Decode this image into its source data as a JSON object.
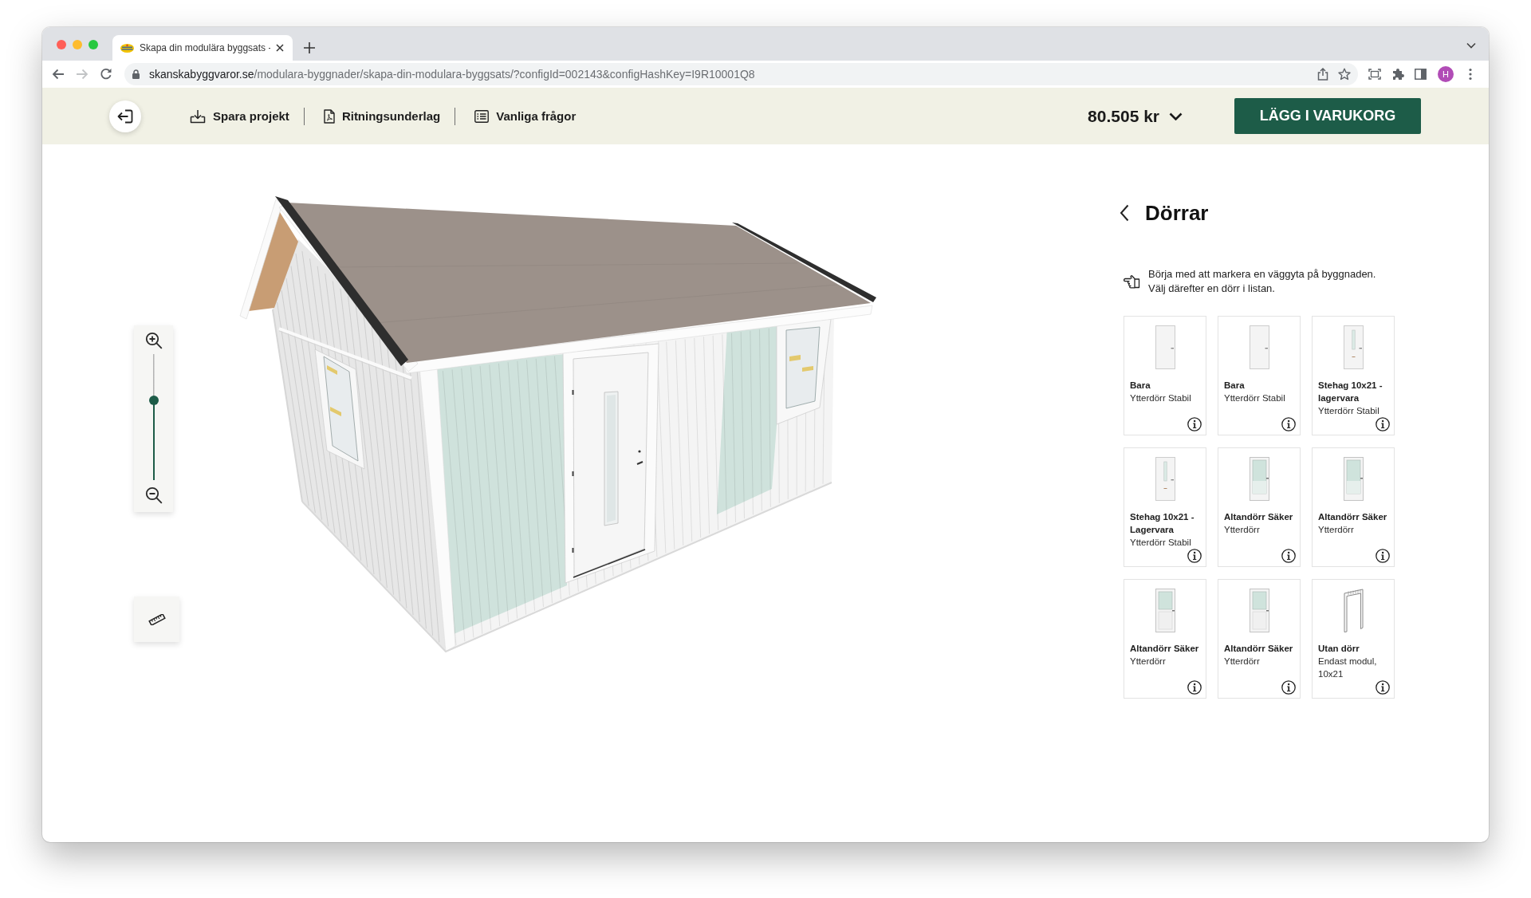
{
  "browser": {
    "tabs": [
      {
        "title": "Skapa din modulära byggsats -",
        "selected": true
      }
    ],
    "back_disabled": false,
    "forward_disabled": true,
    "url": {
      "host": "skanskabyggvaror.se",
      "path": "/modulara-byggnader/skapa-din-modulara-byggsats/?configId=002143&configHashKey=I9R10001Q8"
    },
    "profile": "H"
  },
  "header": {
    "actions": [
      {
        "label": "Spara projekt",
        "kind": "save"
      },
      {
        "label": "Ritningsunderlag",
        "kind": "pdf"
      },
      {
        "label": "Vanliga frågor",
        "kind": "faq"
      }
    ],
    "price": "80.505 kr",
    "cart_button": "LÄGG I VARUKORG"
  },
  "viewer": {
    "zoom": {
      "level": 0.63
    }
  },
  "panel": {
    "title": "Dörrar",
    "hint": "Börja med att markera en väggyta på byggnaden. Välj därefter en dörr i listan.",
    "doors": [
      {
        "name": "Bara",
        "subtitle": "Ytterdörr Stabil",
        "kind": "solid"
      },
      {
        "name": "Bara",
        "subtitle": "Ytterdörr Stabil",
        "kind": "solid"
      },
      {
        "name": "Stehag 10x21 - lagervara",
        "subtitle": "Ytterdörr Stabil",
        "kind": "slim"
      },
      {
        "name": "Stehag 10x21 - Lagervara",
        "subtitle": "Ytterdörr Stabil",
        "kind": "slim"
      },
      {
        "name": "Altandörr Säker",
        "subtitle": "Ytterdörr",
        "kind": "glass"
      },
      {
        "name": "Altandörr Säker",
        "subtitle": "Ytterdörr",
        "kind": "glass"
      },
      {
        "name": "Altandörr Säker",
        "subtitle": "Ytterdörr",
        "kind": "half"
      },
      {
        "name": "Altandörr Säker",
        "subtitle": "Ytterdörr",
        "kind": "half"
      },
      {
        "name": "Utan dörr",
        "subtitle": "Endast modul, 10x21",
        "kind": "frame"
      }
    ]
  }
}
